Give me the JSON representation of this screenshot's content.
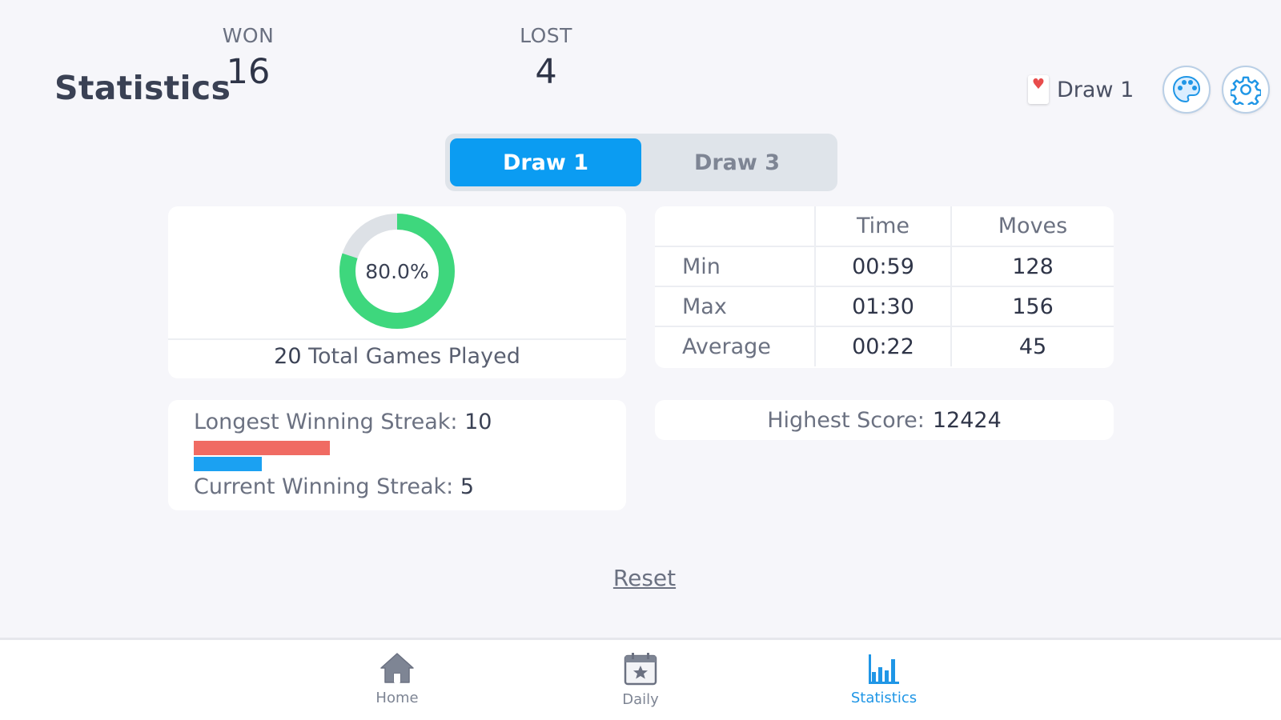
{
  "header": {
    "title": "Statistics",
    "mode_indicator": {
      "icon": "heart-card-icon",
      "label": "Draw 1"
    },
    "buttons": [
      {
        "name": "theme-button",
        "icon": "palette-icon"
      },
      {
        "name": "settings-button",
        "icon": "gear-icon"
      }
    ]
  },
  "segmented": {
    "tabs": [
      {
        "label": "Draw 1",
        "active": true
      },
      {
        "label": "Draw 3",
        "active": false
      }
    ]
  },
  "win_loss": {
    "won_label": "WON",
    "won_value": "16",
    "lost_label": "LOST",
    "lost_value": "4",
    "win_percent": 80.0,
    "win_percent_text": "80.0%",
    "total_count": "20",
    "total_label": "Total Games Played"
  },
  "streaks": {
    "longest_label": "Longest Winning Streak:",
    "longest_value": "10",
    "current_label": "Current Winning Streak:",
    "current_value": "5",
    "longest": 10,
    "current": 5
  },
  "time_moves": {
    "headers": [
      "",
      "Time",
      "Moves"
    ],
    "rows": [
      {
        "label": "Min",
        "time": "00:59",
        "moves": "128"
      },
      {
        "label": "Max",
        "time": "01:30",
        "moves": "156"
      },
      {
        "label": "Average",
        "time": "00:22",
        "moves": "45"
      }
    ]
  },
  "score": {
    "label": "Highest Score:",
    "value": "12424"
  },
  "reset_label": "Reset",
  "bottom_nav": [
    {
      "label": "Home",
      "icon": "home-icon",
      "active": false
    },
    {
      "label": "Daily",
      "icon": "calendar-star-icon",
      "active": false
    },
    {
      "label": "Statistics",
      "icon": "bar-chart-icon",
      "active": true
    }
  ],
  "colors": {
    "accent": "#0b9cf2",
    "win": "#3ed77d",
    "loss_track": "#dde1e6",
    "longest_bar": "#f06b63",
    "current_bar": "#1ba1f2"
  }
}
